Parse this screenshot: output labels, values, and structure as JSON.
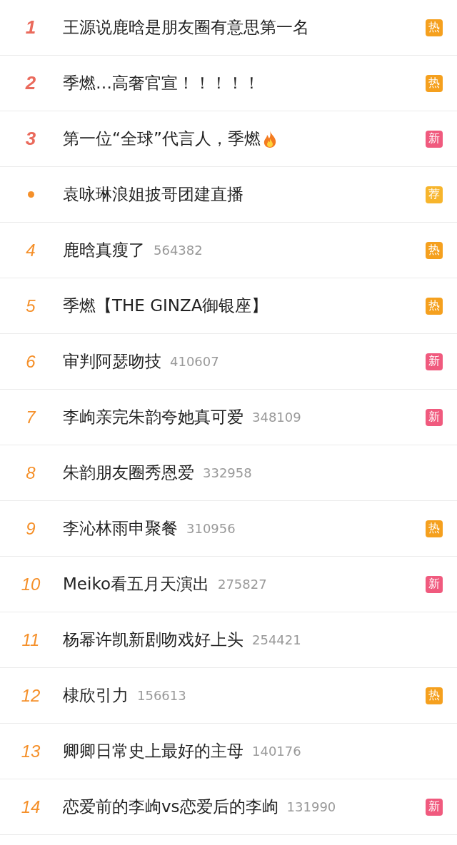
{
  "hot_list": [
    {
      "kind": "top",
      "rank": "1",
      "title": "王源说鹿晗是朋友圈有意思第一名",
      "badge": {
        "kind": "hot",
        "label": "热"
      }
    },
    {
      "kind": "top",
      "rank": "2",
      "title": "季燃…高奢官宣！！！！！",
      "badge": {
        "kind": "hot",
        "label": "热"
      }
    },
    {
      "kind": "top",
      "rank": "3",
      "title": "第一位“全球”代言人，季燃",
      "fire": true,
      "badge": {
        "kind": "new",
        "label": "新"
      }
    },
    {
      "kind": "promoted",
      "title": "袁咏琳浪姐披哥团建直播",
      "badge": {
        "kind": "recommend",
        "label": "荐"
      }
    },
    {
      "kind": "normal",
      "rank": "4",
      "title": "鹿晗真瘦了",
      "count": "564382",
      "badge": {
        "kind": "hot",
        "label": "热"
      }
    },
    {
      "kind": "normal",
      "rank": "5",
      "title": "季燃【THE GINZA御银座】",
      "badge": {
        "kind": "hot",
        "label": "热"
      }
    },
    {
      "kind": "normal",
      "rank": "6",
      "title": "审判阿瑟吻技",
      "count": "410607",
      "badge": {
        "kind": "new",
        "label": "新"
      }
    },
    {
      "kind": "normal",
      "rank": "7",
      "title": "李岣亲完朱韵夸她真可爱",
      "count": "348109",
      "badge": {
        "kind": "new",
        "label": "新"
      }
    },
    {
      "kind": "normal",
      "rank": "8",
      "title": "朱韵朋友圈秀恩爱",
      "count": "332958"
    },
    {
      "kind": "normal",
      "rank": "9",
      "title": "李沁林雨申聚餐",
      "count": "310956",
      "badge": {
        "kind": "hot",
        "label": "热"
      }
    },
    {
      "kind": "normal",
      "rank": "10",
      "title": "Meiko看五月天演出",
      "count": "275827",
      "badge": {
        "kind": "new",
        "label": "新"
      }
    },
    {
      "kind": "normal",
      "rank": "11",
      "title": "杨幂许凯新剧吻戏好上头",
      "count": "254421"
    },
    {
      "kind": "normal",
      "rank": "12",
      "title": "棣欣引力",
      "count": "156613",
      "badge": {
        "kind": "hot",
        "label": "热"
      }
    },
    {
      "kind": "normal",
      "rank": "13",
      "title": "卿卿日常史上最好的主母",
      "count": "140176"
    },
    {
      "kind": "normal",
      "rank": "14",
      "title": "恋爱前的李岣vs恋爱后的李岣",
      "count": "131990",
      "badge": {
        "kind": "new",
        "label": "新"
      }
    }
  ]
}
